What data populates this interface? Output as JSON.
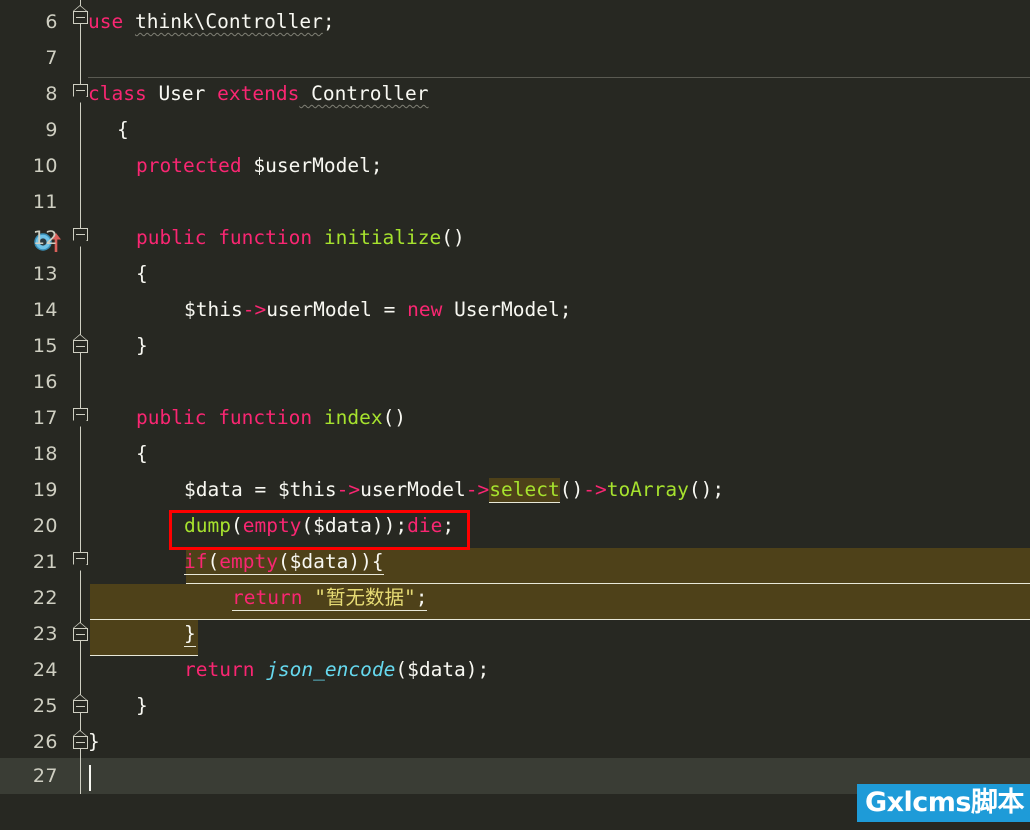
{
  "editor": {
    "language": "PHP",
    "theme": "Monokai Dark",
    "first_visible_line": 6,
    "last_visible_line": 27,
    "current_line": 27,
    "colors": {
      "background": "#272822",
      "current_line": "#3A3D35",
      "keyword": "#F92672",
      "function": "#A6E22E",
      "string": "#E6DB74",
      "builtin": "#66D9EF",
      "identifier": "#F8F8F2",
      "line_number": "#CFCFC2",
      "occurrence_highlight": "#4E4119",
      "annotation_box": "#FF0000",
      "watermark_background": "#1E9BD8"
    },
    "lines": [
      {
        "num": "6",
        "indent": 0,
        "text": "use think\\Controller;"
      },
      {
        "num": "7",
        "indent": 0,
        "text": ""
      },
      {
        "num": "8",
        "indent": 0,
        "text": "class User extends Controller"
      },
      {
        "num": "9",
        "indent": 1,
        "text": "{"
      },
      {
        "num": "10",
        "indent": 2,
        "text": "protected $userModel;"
      },
      {
        "num": "11",
        "indent": 0,
        "text": ""
      },
      {
        "num": "12",
        "indent": 2,
        "text": "public function initialize()"
      },
      {
        "num": "13",
        "indent": 2,
        "text": "{"
      },
      {
        "num": "14",
        "indent": 3,
        "text": "$this->userModel = new UserModel;"
      },
      {
        "num": "15",
        "indent": 2,
        "text": "}"
      },
      {
        "num": "16",
        "indent": 0,
        "text": ""
      },
      {
        "num": "17",
        "indent": 2,
        "text": "public function index()"
      },
      {
        "num": "18",
        "indent": 2,
        "text": "{"
      },
      {
        "num": "19",
        "indent": 3,
        "text": "$data = $this->userModel->select()->toArray();"
      },
      {
        "num": "20",
        "indent": 3,
        "text": "dump(empty($data));die;"
      },
      {
        "num": "21",
        "indent": 3,
        "text": "if(empty($data)){"
      },
      {
        "num": "22",
        "indent": 4,
        "text": "return \"暂无数据\";"
      },
      {
        "num": "23",
        "indent": 3,
        "text": "}"
      },
      {
        "num": "24",
        "indent": 3,
        "text": "return json_encode($data);"
      },
      {
        "num": "25",
        "indent": 2,
        "text": "}"
      },
      {
        "num": "26",
        "indent": 1,
        "text": "}"
      },
      {
        "num": "27",
        "indent": 0,
        "text": ""
      }
    ],
    "tokens": {
      "l6_use": "use",
      "l6_ns": "think\\Controller",
      "l6_semi": ";",
      "l8_class": "class",
      "l8_name": " User ",
      "l8_extends": "extends",
      "l8_parent": " Controller",
      "l9_brace": "{",
      "l10_protected": "protected",
      "l10_var": " $userModel;",
      "l12_public": "public",
      "l12_function": " function ",
      "l12_name": "initialize",
      "l12_parens": "()",
      "l13_brace": "{",
      "l14_this": "$this",
      "l14_arrow": "->",
      "l14_prop": "userModel",
      "l14_eq": " = ",
      "l14_new": "new",
      "l14_cls": " UserModel;",
      "l15_brace": "}",
      "l17_public": "public",
      "l17_function": " function ",
      "l17_name": "index",
      "l17_parens": "()",
      "l18_brace": "{",
      "l19_data": "$data",
      "l19_eq": " = ",
      "l19_this": "$this",
      "l19_arrow1": "->",
      "l19_prop": "userModel",
      "l19_arrow2": "->",
      "l19_select": "select",
      "l19_parens1": "()",
      "l19_arrow3": "->",
      "l19_toarray": "toArray",
      "l19_parens2": "();",
      "l20_dump": "dump",
      "l20_open": "(",
      "l20_empty": "empty",
      "l20_arg": "($data));",
      "l20_die": "die",
      "l20_semi": ";",
      "l21_if": "if",
      "l21_open": "(",
      "l21_empty": "empty",
      "l21_rest": "($data)){",
      "l22_return": "return",
      "l22_space": " ",
      "l22_str": "\"暂无数据\"",
      "l22_semi": ";",
      "l23_brace": "}",
      "l24_return": "return",
      "l24_space": " ",
      "l24_fn": "json_encode",
      "l24_args": "($data);",
      "l25_brace": "}",
      "l26_brace": "}"
    },
    "gutter_icon": {
      "line": "12",
      "name": "overriding-method-marker",
      "label": "O"
    }
  },
  "watermark": {
    "text": "Gxlcms脚本"
  }
}
